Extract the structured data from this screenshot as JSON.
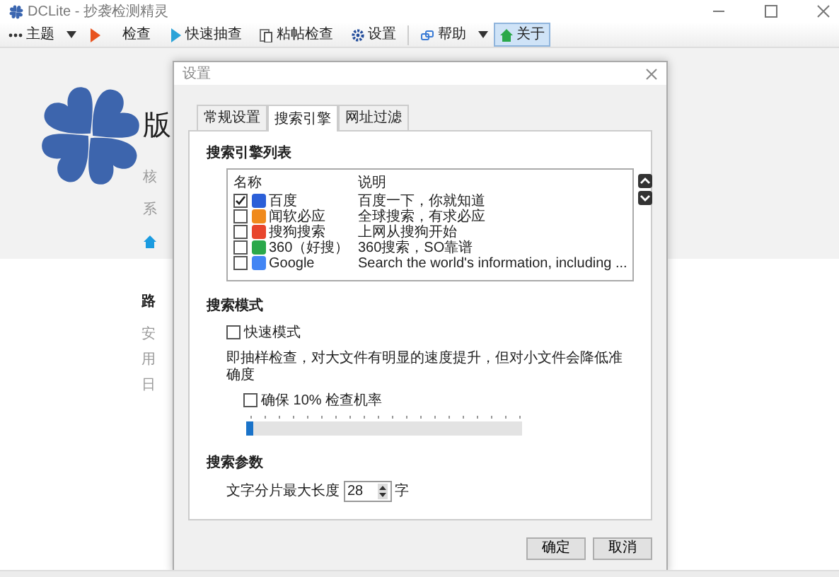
{
  "window": {
    "title": "DCLite - 抄袭检测精灵"
  },
  "toolbar": [
    {
      "kind": "theme",
      "label": "主题",
      "selected": false
    },
    {
      "kind": "caret"
    },
    {
      "kind": "check",
      "label": "检查",
      "selected": false
    },
    {
      "kind": "quick",
      "label": "快速抽查",
      "selected": false
    },
    {
      "kind": "paste",
      "label": "粘帖检查",
      "selected": false
    },
    {
      "kind": "settings",
      "label": "设置",
      "selected": false
    },
    {
      "kind": "separator"
    },
    {
      "kind": "help",
      "label": "帮助",
      "selected": false
    },
    {
      "kind": "caret"
    },
    {
      "kind": "about",
      "label": "关于",
      "selected": true
    }
  ],
  "background": {
    "heading": "版",
    "lines": [
      "核",
      "系"
    ],
    "section_heading": "路",
    "section_lines": [
      "安",
      "用",
      "日"
    ]
  },
  "dialog": {
    "title": "设置",
    "tabs": [
      {
        "label": "常规设置",
        "selected": false
      },
      {
        "label": "搜索引擎",
        "selected": true
      },
      {
        "label": "网址过滤",
        "selected": false
      }
    ],
    "engine_list": {
      "heading": "搜索引擎列表",
      "columns": [
        "名称",
        "说明"
      ],
      "rows": [
        {
          "name": "百度",
          "description": "百度一下，你就知道",
          "checked": true,
          "color": "#2b5fd8"
        },
        {
          "name": "闻软必应",
          "description": "全球搜索，有求必应",
          "checked": false,
          "color": "#f08a1c"
        },
        {
          "name": "搜狗搜索",
          "description": "上网从搜狗开始",
          "checked": false,
          "color": "#e8452c"
        },
        {
          "name": "360（好搜）",
          "description": "360搜索，SO靠谱",
          "checked": false,
          "color": "#2aa84a"
        },
        {
          "name": "Google",
          "description": "Search the world's information, including ...",
          "checked": false,
          "color": "#4285f4"
        }
      ]
    },
    "search_mode": {
      "heading": "搜索模式",
      "fast_mode": {
        "label": "快速模式",
        "checked": false
      },
      "description": "即抽样检查，对大文件有明显的速度提升，但对小文件会降低准确度",
      "guarantee": {
        "label": "确保 10% 检查机率",
        "checked": false
      },
      "slider": {
        "level": 0
      }
    },
    "params": {
      "heading": "搜索参数",
      "label": "文字分片最大长度",
      "value": "28",
      "unit": "字"
    },
    "buttons": [
      "确定",
      "取消"
    ]
  }
}
